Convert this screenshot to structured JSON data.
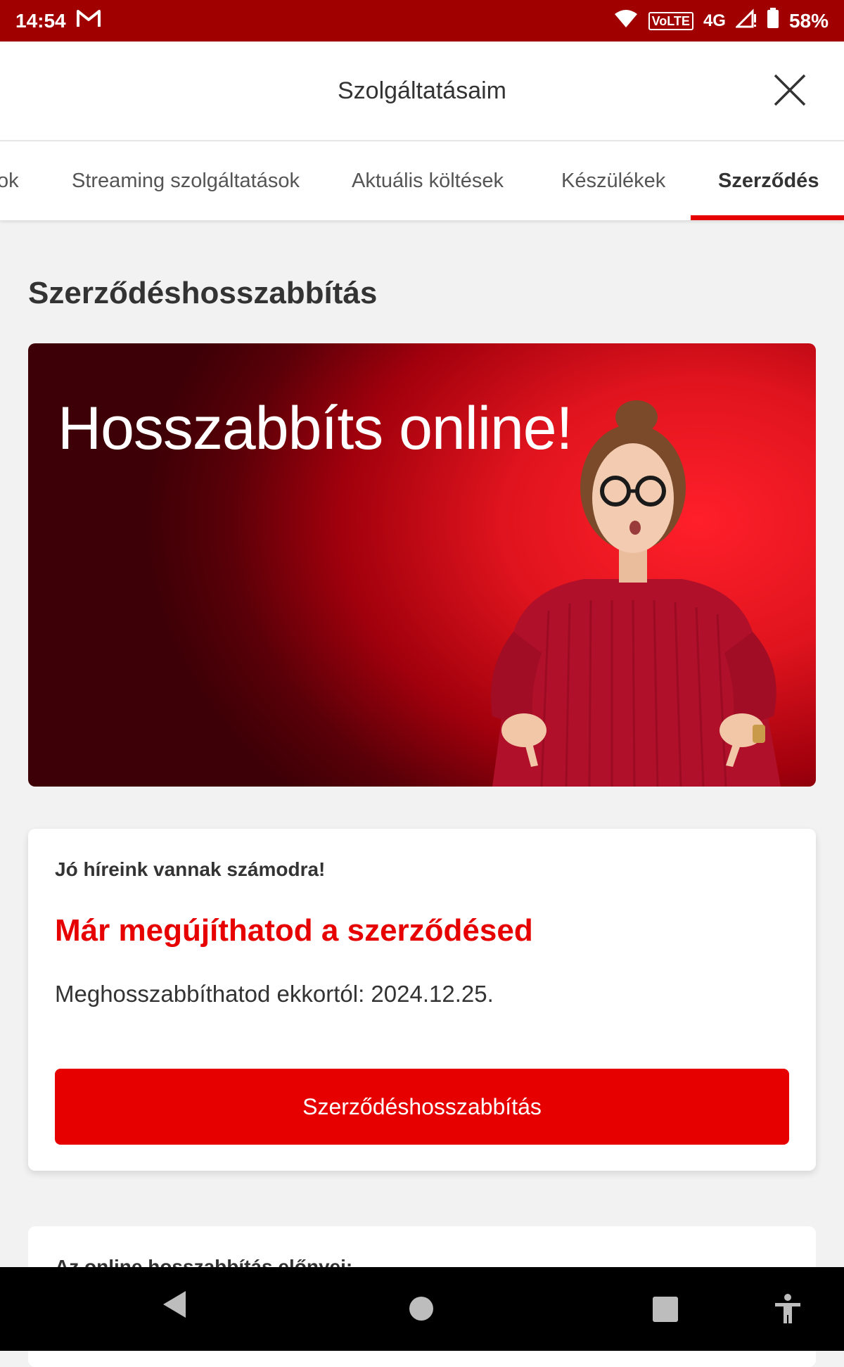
{
  "status_bar": {
    "time": "14:54",
    "volte": "VoLTE",
    "network": "4G",
    "battery": "58%"
  },
  "header": {
    "title": "Szolgáltatásaim",
    "close_icon": "close-icon"
  },
  "tabs": [
    {
      "label": "ok"
    },
    {
      "label": "Streaming szolgáltatások"
    },
    {
      "label": "Aktuális költések"
    },
    {
      "label": "Készülékek"
    },
    {
      "label": "Szerződés",
      "active": true
    }
  ],
  "section": {
    "title": "Szerződéshosszabbítás"
  },
  "banner": {
    "headline": "Hosszabbíts online!"
  },
  "card": {
    "eyebrow": "Jó híreink vannak számodra!",
    "heading": "Már megújíthatod a szerződésed",
    "text": "Meghosszabbíthatod ekkortól: 2024.12.25.",
    "button_label": "Szerződéshosszabbítás"
  },
  "card2": {
    "title": "Az online hosszabbítás előnyei:"
  },
  "colors": {
    "brand_red": "#e60000",
    "status_bar": "#a00000"
  }
}
